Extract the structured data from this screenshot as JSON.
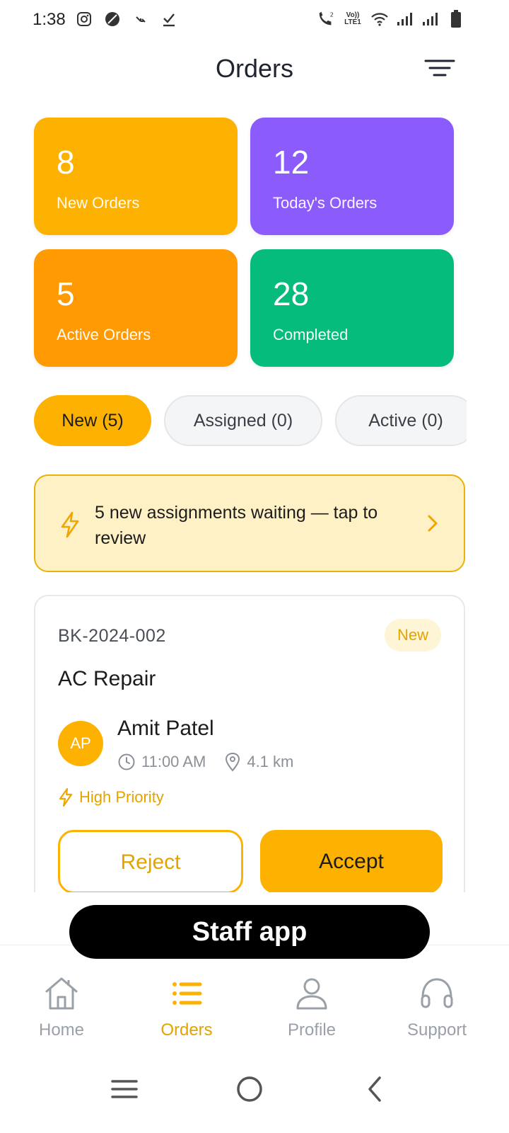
{
  "status_bar": {
    "time": "1:38",
    "icons": [
      "instagram-icon",
      "leaf-icon",
      "signal-arrow-icon",
      "download-check-icon",
      "wifi-call-icon",
      "volte-icon",
      "wifi-icon",
      "signal-icon",
      "signal-icon",
      "battery-icon"
    ],
    "volte_top": "Vo))",
    "volte_bottom": "LTE1"
  },
  "header": {
    "title": "Orders",
    "filter_icon": "filter-icon"
  },
  "stats": [
    {
      "value": "8",
      "label": "New Orders",
      "color": "#FDB201"
    },
    {
      "value": "12",
      "label": "Today's Orders",
      "color": "#8C5BFB"
    },
    {
      "value": "5",
      "label": "Active Orders",
      "color": "#FF9A02"
    },
    {
      "value": "28",
      "label": "Completed",
      "color": "#05BC7C"
    }
  ],
  "tabs": [
    {
      "label": "New (5)",
      "selected": true
    },
    {
      "label": "Assigned (0)",
      "selected": false
    },
    {
      "label": "Active (0)",
      "selected": false
    }
  ],
  "banner": {
    "text": "5 new assignments waiting — tap to review",
    "icon": "lightning-icon",
    "chevron": "chevron-right-icon"
  },
  "order": {
    "id": "BK-2024-002",
    "status": "New",
    "service": "AC Repair",
    "customer_initials": "AP",
    "customer_name": "Amit Patel",
    "time": "11:00 AM",
    "distance": "4.1 km",
    "priority": "High Priority",
    "reject_label": "Reject",
    "accept_label": "Accept"
  },
  "overlay_label": "Staff app",
  "bottom_nav": [
    {
      "label": "Home",
      "icon": "home-icon",
      "active": false
    },
    {
      "label": "Orders",
      "icon": "list-icon",
      "active": true
    },
    {
      "label": "Profile",
      "icon": "user-icon",
      "active": false
    },
    {
      "label": "Support",
      "icon": "headset-icon",
      "active": false
    }
  ],
  "colors": {
    "accent": "#FDB201",
    "accent_text": "#E3A300",
    "banner_bg": "#FEF1C6"
  }
}
